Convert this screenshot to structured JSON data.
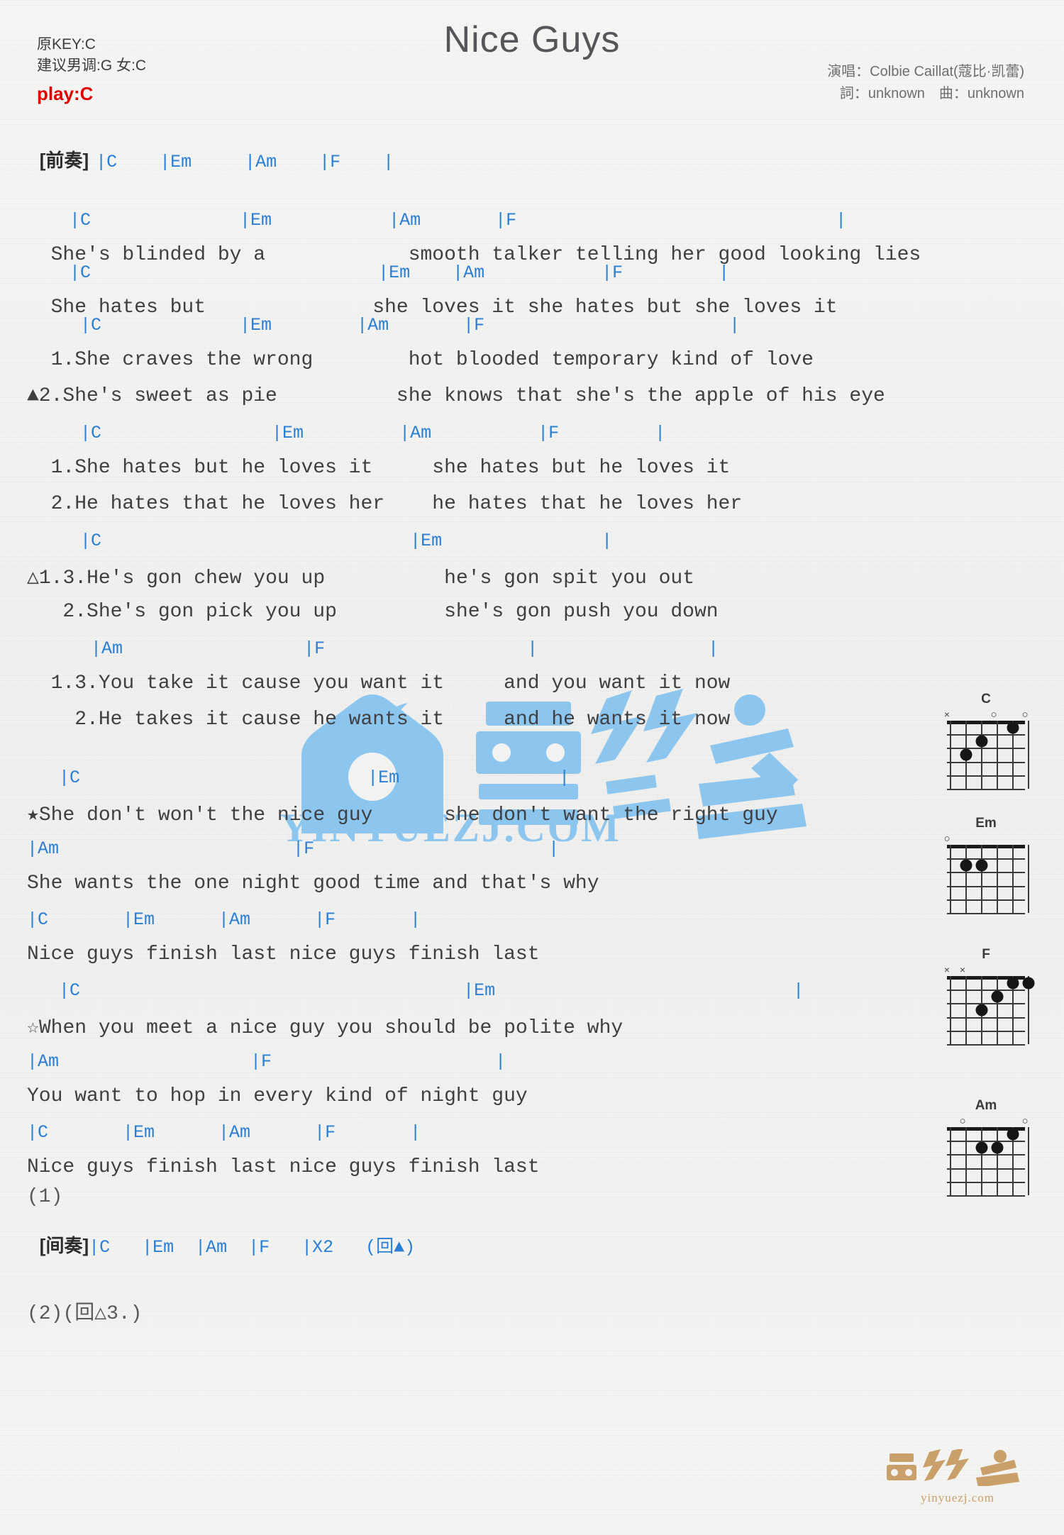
{
  "header": {
    "title": "Nice Guys",
    "original_key": "原KEY:C",
    "suggested_key": "建议男调:G 女:C",
    "play_key": "play:C",
    "singer": "演唱：Colbie Caillat(蔻比·凯蕾)",
    "writer": "詞：unknown　曲：unknown"
  },
  "intro": {
    "tag": "[前奏]",
    "chords": "|C    |Em     |Am    |F    |"
  },
  "sections": [
    {
      "chords": "    |C              |Em           |Am       |F                              |",
      "lyrics": [
        "  She's blinded by a            smooth talker telling her good looking lies"
      ]
    },
    {
      "chords": "    |C                           |Em    |Am           |F         |",
      "lyrics": [
        "  She hates but              she loves it she hates but she loves it"
      ]
    },
    {
      "chords": "     |C             |Em        |Am       |F                       |",
      "lyrics": [
        "  1.She craves the wrong        hot blooded temporary kind of love",
        "▲2.She's sweet as pie          she knows that she's the apple of his eye"
      ]
    },
    {
      "chords": "     |C                |Em         |Am          |F         |",
      "lyrics": [
        "  1.She hates but he loves it     she hates but he loves it",
        "  2.He hates that he loves her    he hates that he loves her"
      ]
    },
    {
      "chords": "     |C                             |Em               |",
      "lyrics": [
        "△1.3.He's gon chew you up          he's gon spit you out",
        "   2.She's gon pick you up         she's gon push you down"
      ]
    },
    {
      "chords": "      |Am                 |F                   |                |",
      "lyrics": [
        "  1.3.You take it cause you want it     and you want it now",
        "    2.He takes it cause he wants it     and he wants it now"
      ]
    }
  ],
  "chorus": [
    {
      "chords": "   |C                           |Em               |",
      "lyrics": [
        "★She don't won't the nice guy      she don't want the right guy"
      ]
    },
    {
      "chords": "|Am                      |F                      |",
      "lyrics": [
        "She wants the one night good time and that's why"
      ]
    },
    {
      "chords": "|C       |Em      |Am      |F       |",
      "lyrics": [
        "Nice guys finish last nice guys finish last"
      ]
    },
    {
      "chords": "   |C                                    |Em                            |",
      "lyrics": [
        "☆When you meet a nice guy you should be polite why"
      ]
    },
    {
      "chords": "|Am                  |F                     |",
      "lyrics": [
        "You want to hop in every kind of night guy"
      ]
    },
    {
      "chords": "|C       |Em      |Am      |F       |",
      "lyrics": [
        "Nice guys finish last nice guys finish last"
      ]
    }
  ],
  "ending": {
    "repeat_1": "(1)",
    "interlude_tag": "[间奏]",
    "interlude_chords": "|C   |Em  |Am  |F   |X2   (回▲)",
    "repeat_2": "(2)(回△3.)"
  },
  "chord_diagrams": [
    {
      "name": "C",
      "markers": [
        {
          "string": 6,
          "type": "x"
        },
        {
          "string": 3,
          "type": "o"
        },
        {
          "string": 1,
          "type": "o"
        }
      ],
      "dots": [
        {
          "string": 5,
          "fret": 3
        },
        {
          "string": 4,
          "fret": 2
        },
        {
          "string": 2,
          "fret": 1
        }
      ]
    },
    {
      "name": "Em",
      "markers": [
        {
          "string": 6,
          "type": "o"
        }
      ],
      "dots": [
        {
          "string": 5,
          "fret": 2
        },
        {
          "string": 4,
          "fret": 2
        }
      ]
    },
    {
      "name": "F",
      "markers": [
        {
          "string": 6,
          "type": "x"
        },
        {
          "string": 5,
          "type": "x"
        }
      ],
      "dots": [
        {
          "string": 4,
          "fret": 3
        },
        {
          "string": 3,
          "fret": 2
        },
        {
          "string": 2,
          "fret": 1
        },
        {
          "string": 1,
          "fret": 1
        }
      ]
    },
    {
      "name": "Am",
      "markers": [
        {
          "string": 5,
          "type": "o"
        },
        {
          "string": 1,
          "type": "o"
        }
      ],
      "dots": [
        {
          "string": 4,
          "fret": 2
        },
        {
          "string": 3,
          "fret": 2
        },
        {
          "string": 2,
          "fret": 1
        }
      ]
    }
  ],
  "watermark": {
    "site": "YINYUEZJ.COM",
    "footer_site": "yinyuezj.com",
    "brand_color": "#8cc6ef"
  }
}
